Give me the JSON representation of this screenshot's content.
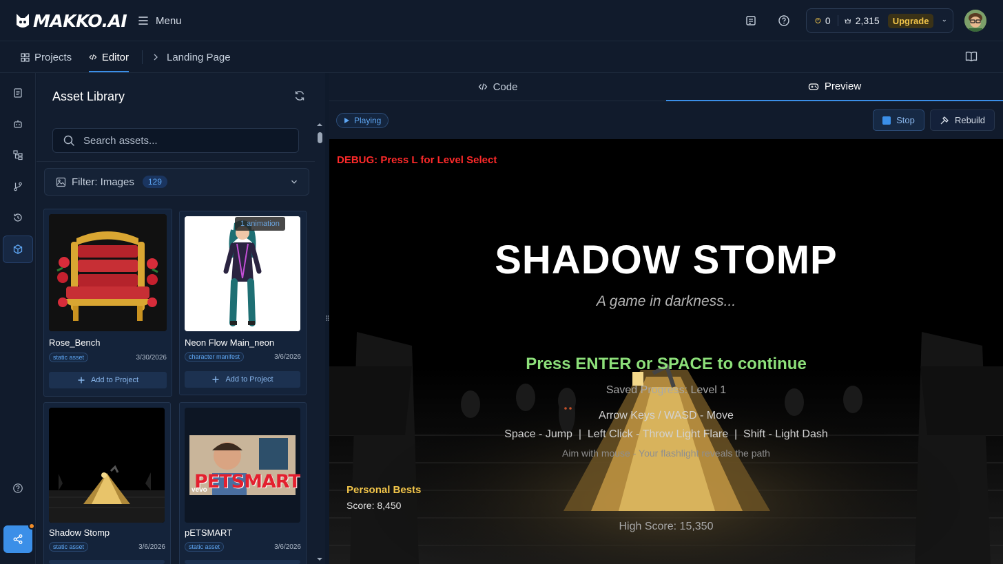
{
  "header": {
    "logo_text": "MAKKO.AI",
    "menu_label": "Menu",
    "credits": {
      "palette_value": "0",
      "crown_value": "2,315",
      "upgrade_label": "Upgrade"
    },
    "colors": {
      "accent": "#3b8fe8",
      "upgrade": "#f3c64a"
    }
  },
  "breadcrumbs": {
    "projects": "Projects",
    "editor": "Editor",
    "page": "Landing Page"
  },
  "asset_library": {
    "title": "Asset Library",
    "search_placeholder": "Search assets...",
    "filter_label": "Filter: Images",
    "filter_count": "129",
    "cards": [
      {
        "name": "Rose_Bench",
        "tag": "static asset",
        "date": "3/30/2026",
        "add_label": "Add to Project"
      },
      {
        "name": "Neon Flow Main_neon",
        "tag": "character manifest",
        "date": "3/6/2026",
        "add_label": "Add to Project",
        "badge": "1 animation"
      },
      {
        "name": "Shadow Stomp",
        "tag": "static asset",
        "date": "3/6/2026"
      },
      {
        "name": "pETSMART",
        "tag": "static asset",
        "date": "3/6/2026",
        "thumb_text": "PETSMART",
        "thumb_sub": "vevo"
      }
    ]
  },
  "tabs": {
    "code": "Code",
    "preview": "Preview"
  },
  "toolbar": {
    "status": "Playing",
    "stop": "Stop",
    "rebuild": "Rebuild"
  },
  "game": {
    "debug": "DEBUG: Press L for Level Select",
    "title": "SHADOW STOMP",
    "subtitle": "A game in darkness...",
    "press": "Press ENTER or SPACE to continue",
    "saved": "Saved Progress: Level 1",
    "move": "Arrow Keys / WASD - Move",
    "controls": "Space - Jump  |  Left Click - Throw Light Flare  |  Shift - Light Dash",
    "aim": "Aim with mouse - Your flashlight reveals the path",
    "personal_bests_title": "Personal Bests",
    "personal_score": "Score: 8,450",
    "high_score": "High Score: 15,350"
  }
}
